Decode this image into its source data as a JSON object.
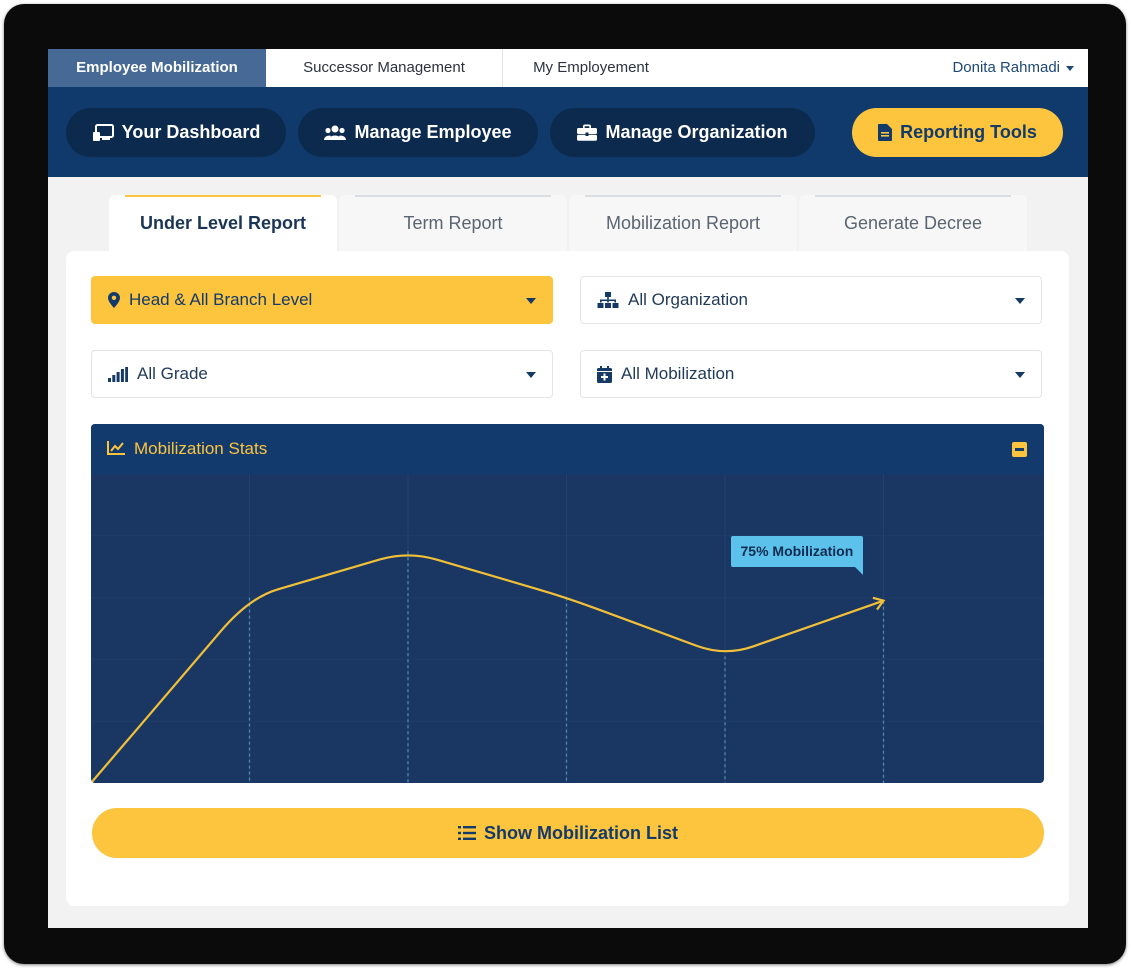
{
  "top_tabs": [
    {
      "label": "Employee Mobilization",
      "active": true
    },
    {
      "label": "Successor Management",
      "active": false
    },
    {
      "label": "My Employement",
      "active": false
    }
  ],
  "user": {
    "name": "Donita Rahmadi",
    "icon": "caret-down-icon"
  },
  "nav": [
    {
      "label": "Your Dashboard",
      "icon": "dashboard-icon"
    },
    {
      "label": "Manage Employee",
      "icon": "users-icon"
    },
    {
      "label": "Manage Organization",
      "icon": "briefcase-icon"
    },
    {
      "label": "Reporting Tools",
      "icon": "file-icon",
      "active": true
    }
  ],
  "report_tabs": [
    {
      "label": "Under Level Report",
      "active": true
    },
    {
      "label": "Term Report",
      "active": false
    },
    {
      "label": "Mobilization Report",
      "active": false
    },
    {
      "label": "Generate Decree",
      "active": false
    }
  ],
  "filters": {
    "level": {
      "value": "Head & All Branch Level",
      "icon": "map-marker-icon"
    },
    "organization": {
      "value": "All Organization",
      "icon": "sitemap-icon"
    },
    "grade": {
      "value": "All Grade",
      "icon": "signal-icon"
    },
    "mobilization": {
      "value": "All Mobilization",
      "icon": "calendar-plus-icon"
    }
  },
  "stats": {
    "title": "Mobilization Stats",
    "icon": "chart-line-icon",
    "callout": "75% Mobilization"
  },
  "chart_data": {
    "type": "line",
    "x": [
      0,
      1,
      2,
      3,
      4,
      5
    ],
    "values": [
      0,
      60,
      75,
      60,
      41,
      59
    ],
    "ylim": [
      0,
      100
    ],
    "grid": true,
    "annotations": [
      "75% Mobilization"
    ],
    "colors": {
      "line": "#f2c038",
      "background": "#193762",
      "guide": "#4f87b3"
    }
  },
  "actions": {
    "show_list": "Show Mobilization List"
  },
  "colors": {
    "primary": "#113a6c",
    "accent": "#fdc43e",
    "tab_active": "#466a95"
  }
}
